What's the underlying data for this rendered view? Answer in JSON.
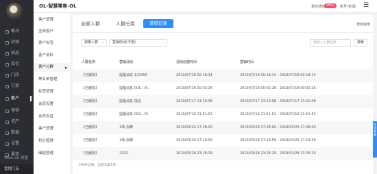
{
  "rail": {
    "items": [
      {
        "label": "概况",
        "icon": "dashboard-icon"
      },
      {
        "label": "店铺",
        "icon": "store-icon"
      },
      {
        "label": "商品",
        "icon": "goods-icon"
      },
      {
        "label": "库存",
        "icon": "inventory-icon"
      },
      {
        "label": "门店",
        "icon": "shop-icon"
      },
      {
        "label": "订单",
        "icon": "order-icon"
      },
      {
        "label": "客户",
        "icon": "customer-icon"
      },
      {
        "label": "营销",
        "icon": "marketing-icon"
      },
      {
        "label": "资产",
        "icon": "asset-icon"
      },
      {
        "label": "数据",
        "icon": "data-icon"
      },
      {
        "label": "设置",
        "icon": "settings-icon"
      },
      {
        "label": "渠道",
        "icon": "channel-icon"
      }
    ],
    "active_index": 6,
    "brand": "Weimob 微盟",
    "footer": "营销门店"
  },
  "topbar": {
    "title": "OL-智慧零售-OL",
    "notice_label": "系统通知",
    "notice_badge": "999+",
    "user_label": "帐号(管理)",
    "menu_icon": "hamburger-icon"
  },
  "subnav": {
    "items": [
      "客户管理",
      "全部客户",
      "客户标签",
      "客户资料",
      "客户分群",
      "黑名单管理",
      "标签管理",
      "会员设置",
      "会员权益",
      "客户管理",
      "积分管理",
      "储值管理"
    ],
    "active_index": 4
  },
  "tabs": {
    "items": [
      "全部人群",
      "人群分类",
      "营销记录"
    ],
    "active_index": 2,
    "help": "使用指南"
  },
  "filters": {
    "type_select": "按推人群",
    "time_select": "营销时间(不限)",
    "search_placeholder": "请输入人群名称",
    "search_button": "搜索"
  },
  "table": {
    "columns": [
      "人群名称",
      "营销活动",
      "活动创建时间",
      "营销时间"
    ],
    "rows": [
      [
        "【已删除】",
        "提醒消息-123456",
        "2019/07/18 00:18:14",
        "2019/07/18 00:18:14 - 2019/07/18 00:18:14"
      ],
      [
        "【已删除】",
        "提醒消息-001---PL",
        "2019/07/18 00:02:26",
        "2019/07/18 00:02:26 - 2019/07/18 00:02:26"
      ],
      [
        "【已删除】",
        "提醒消息-福音",
        "2019/07/17 23:10:08",
        "2019/07/17 23:10:08 - 2019/07/17 23:10:08"
      ],
      [
        "【已删除】",
        "提醒消息-002---PL",
        "2019/07/16 21:51:52",
        "2019/07/16 21:51:52 - 2019/07/16 21:51:52"
      ],
      [
        "【已删除】",
        "1场-加腾",
        "2019/03/29 17:28:00",
        "2019/03/29 17:28:00 - 2019/03/29 17:28:00"
      ],
      [
        "【已删除】",
        "1场-加腾",
        "2019/03/29 17:19:59",
        "2019/03/29 17:19:59 - 2019/03/29 17:19:59"
      ],
      [
        "【已删除】",
        "2323",
        "2019/03/28 23:26:29",
        "2019/03/28 23:26:29 - 2019/03/28 23:26:29"
      ]
    ],
    "footer": "共9条记录，当前为第1页"
  },
  "float_widget": {
    "label": "在线客服"
  },
  "colors": {
    "accent": "#2f8df6",
    "sidebar": "#2b2d33",
    "badge": "#f0506e"
  }
}
